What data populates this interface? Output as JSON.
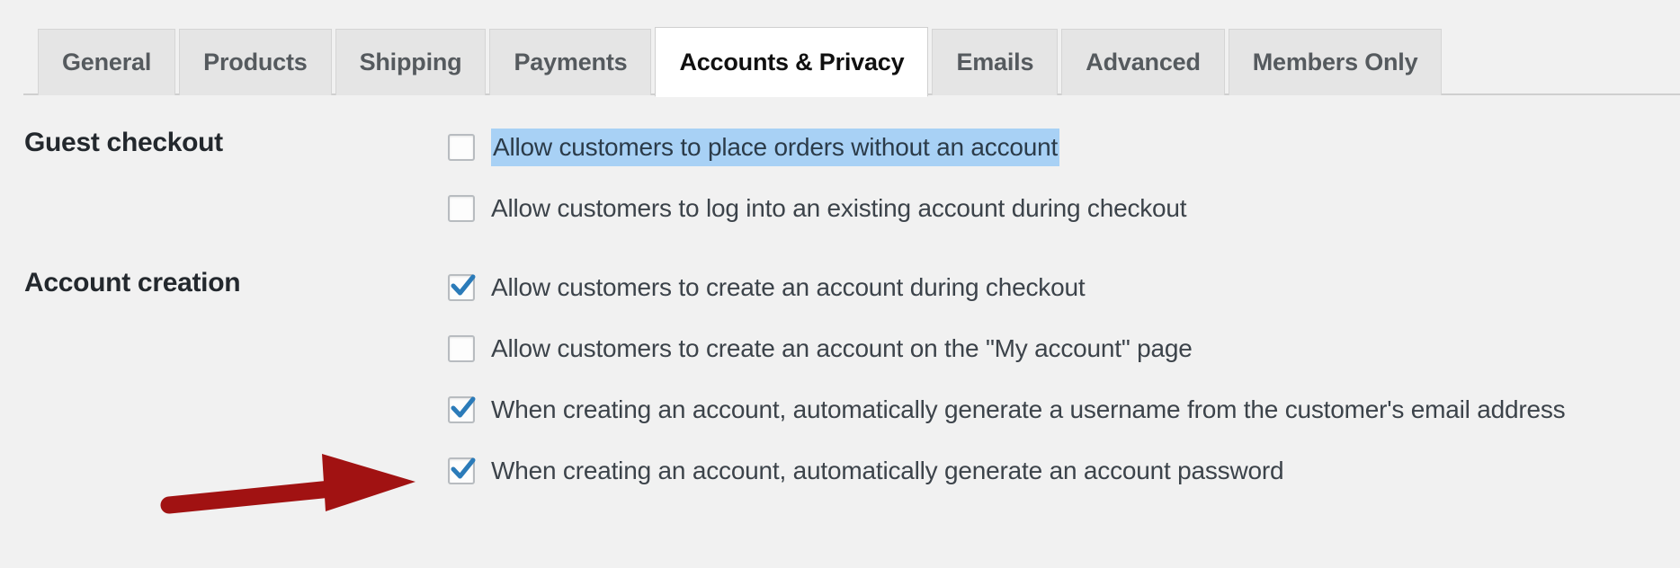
{
  "colors": {
    "page_background": "#f1f1f1",
    "tab_inactive_background": "#e5e5e5",
    "tab_active_background": "#ffffff",
    "label_text": "#23282d",
    "checkbox_check": "#2b7bb9",
    "selection_highlight": "#a8d1f5",
    "annotation_arrow": "#a11212"
  },
  "tabs": [
    {
      "label": "General",
      "active": false
    },
    {
      "label": "Products",
      "active": false
    },
    {
      "label": "Shipping",
      "active": false
    },
    {
      "label": "Payments",
      "active": false
    },
    {
      "label": "Accounts & Privacy",
      "active": true
    },
    {
      "label": "Emails",
      "active": false
    },
    {
      "label": "Advanced",
      "active": false
    },
    {
      "label": "Members Only",
      "active": false
    }
  ],
  "sections": [
    {
      "label": "Guest checkout",
      "options": [
        {
          "label": "Allow customers to place orders without an account",
          "checked": false,
          "selected": true
        },
        {
          "label": "Allow customers to log into an existing account during checkout",
          "checked": false,
          "selected": false
        }
      ]
    },
    {
      "label": "Account creation",
      "options": [
        {
          "label": "Allow customers to create an account during checkout",
          "checked": true,
          "selected": false
        },
        {
          "label": "Allow customers to create an account on the \"My account\" page",
          "checked": false,
          "selected": false
        },
        {
          "label": "When creating an account, automatically generate a username from the customer's email address",
          "checked": true,
          "selected": false
        },
        {
          "label": "When creating an account, automatically generate an account password",
          "checked": true,
          "selected": false
        }
      ]
    }
  ],
  "annotation": {
    "type": "arrow",
    "direction": "right",
    "points_to": "When creating an account, automatically generate a username from the customer's email address"
  }
}
